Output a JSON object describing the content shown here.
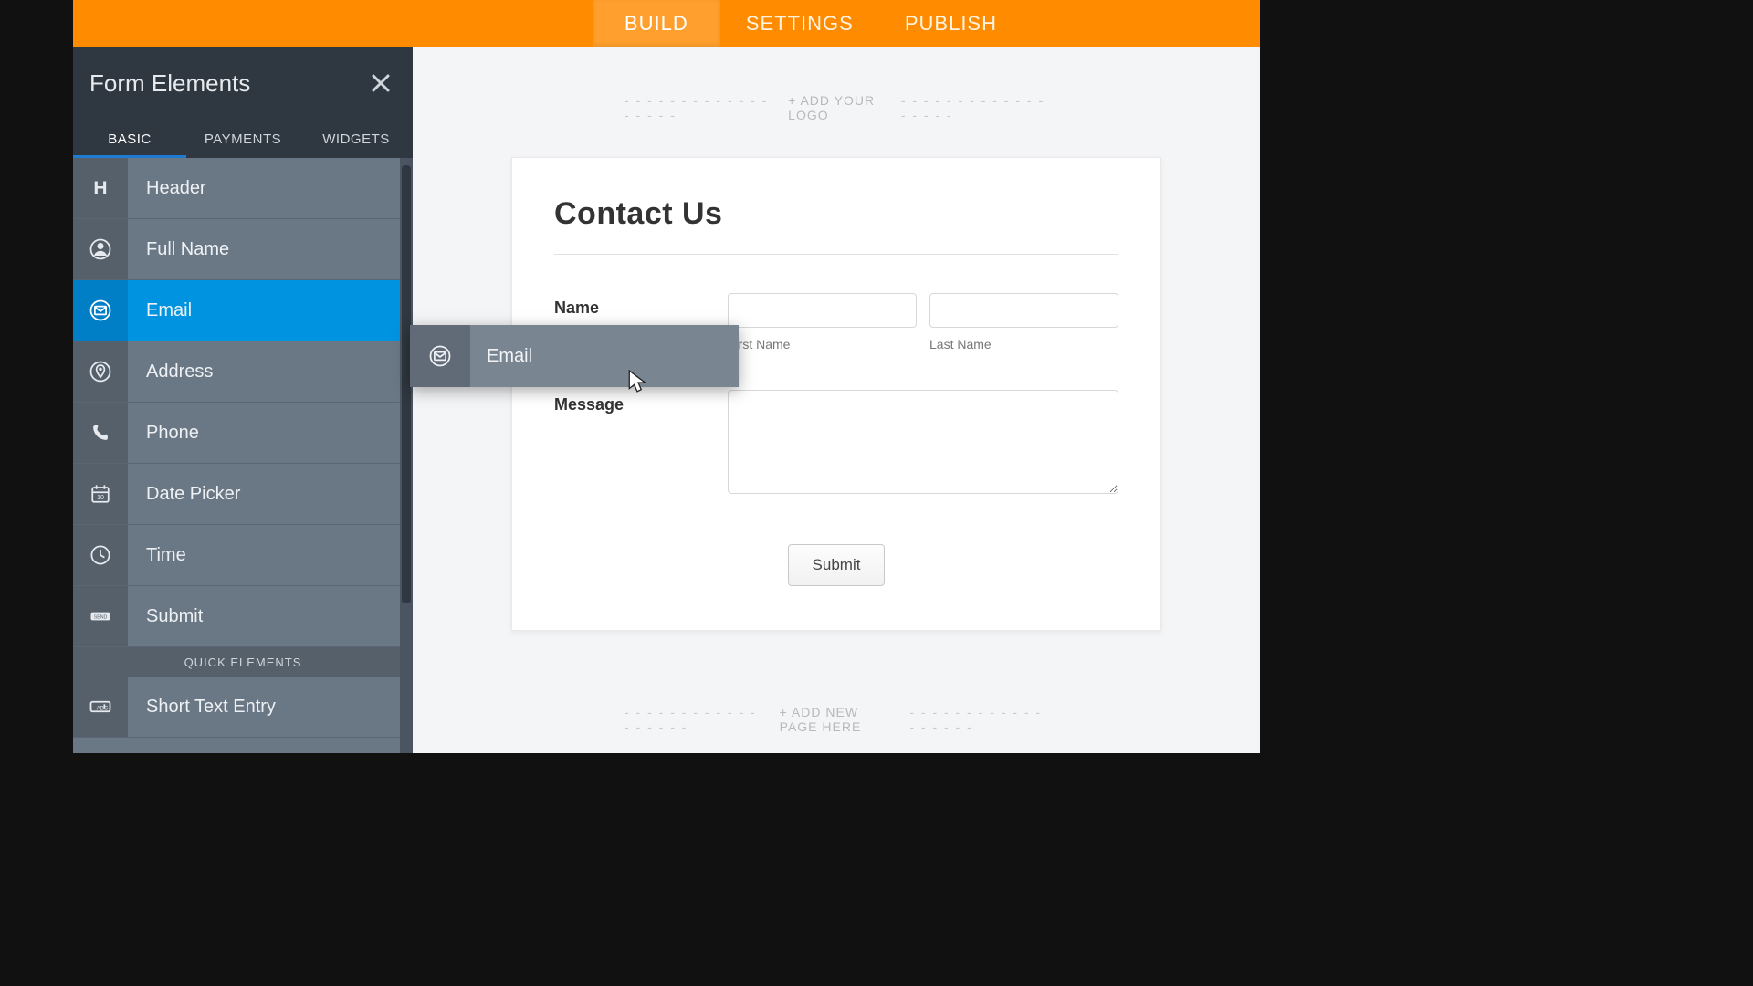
{
  "topnav": {
    "tabs": [
      {
        "label": "BUILD",
        "active": true
      },
      {
        "label": "SETTINGS",
        "active": false
      },
      {
        "label": "PUBLISH",
        "active": false
      }
    ]
  },
  "sidebar": {
    "title": "Form Elements",
    "tabs": [
      {
        "label": "BASIC",
        "active": true
      },
      {
        "label": "PAYMENTS",
        "active": false
      },
      {
        "label": "WIDGETS",
        "active": false
      }
    ],
    "elements": [
      {
        "label": "Header",
        "icon": "header",
        "active": false
      },
      {
        "label": "Full Name",
        "icon": "fullname",
        "active": false
      },
      {
        "label": "Email",
        "icon": "email",
        "active": true
      },
      {
        "label": "Address",
        "icon": "address",
        "active": false
      },
      {
        "label": "Phone",
        "icon": "phone",
        "active": false
      },
      {
        "label": "Date Picker",
        "icon": "datepicker",
        "active": false
      },
      {
        "label": "Time",
        "icon": "time",
        "active": false
      },
      {
        "label": "Submit",
        "icon": "submit",
        "active": false
      }
    ],
    "quick_header": "QUICK ELEMENTS",
    "quick_elements": [
      {
        "label": "Short Text Entry",
        "icon": "shorttext",
        "active": false
      }
    ]
  },
  "drag": {
    "label": "Email",
    "icon": "email"
  },
  "canvas": {
    "logo_text": "+ ADD YOUR LOGO",
    "card_title": "Contact Us",
    "name_label": "Name",
    "first_name_sub": "First Name",
    "last_name_sub": "Last Name",
    "message_label": "Message",
    "submit_label": "Submit",
    "newpage_text": "+ ADD NEW PAGE HERE"
  },
  "colors": {
    "accent": "#0093e0",
    "orange": "#ff8c00"
  }
}
